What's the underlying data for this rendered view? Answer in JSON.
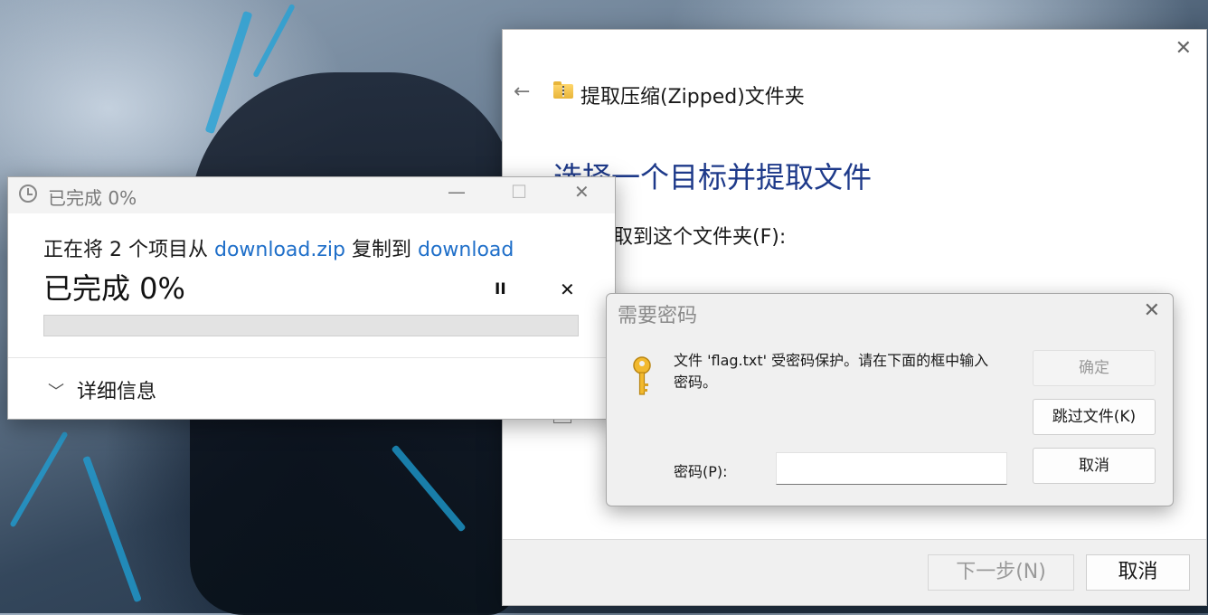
{
  "wizard": {
    "title": "提取压缩(Zipped)文件夹",
    "heading": "选择一个目标并提取文件",
    "folder_label": "将被提取到这个文件夹(F):",
    "next_label": "下一步(N)",
    "cancel_label": "取消"
  },
  "copy_dialog": {
    "title": "已完成 0%",
    "line_prefix": "正在将 2 个项目从 ",
    "source": "download.zip",
    "line_middle": " 复制到 ",
    "destination": "download",
    "percent_text": "已完成 0%",
    "progress": 0,
    "details_label": "详细信息"
  },
  "password_dialog": {
    "title": "需要密码",
    "message": "文件 'flag.txt' 受密码保护。请在下面的框中输入密码。",
    "ok_label": "确定",
    "skip_label": "跳过文件(K)",
    "cancel_label": "取消",
    "password_label": "密码(P):",
    "password_value": ""
  },
  "colors": {
    "accent_link": "#1f6fc9",
    "heading_blue": "#1e3a8a",
    "progress_green": "#06b025"
  }
}
